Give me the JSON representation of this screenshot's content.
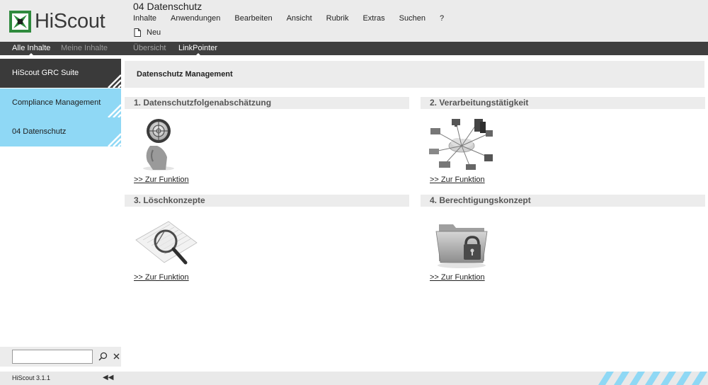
{
  "app": {
    "logo_text": "HiScout",
    "brand_color": "#2f8a3d"
  },
  "header": {
    "doc_title": "04 Datenschutz",
    "menu": [
      "Inhalte",
      "Anwendungen",
      "Bearbeiten",
      "Ansicht",
      "Rubrik",
      "Extras",
      "Suchen",
      "?"
    ],
    "new_label": "Neu"
  },
  "tabs": {
    "left": [
      "Alle Inhalte",
      "Meine Inhalte"
    ],
    "right": [
      "Übersicht",
      "LinkPointer"
    ],
    "active_left": "Alle Inhalte",
    "active_right": "LinkPointer"
  },
  "sidebar": {
    "items": [
      {
        "label": "HiScout GRC Suite",
        "style": "dark"
      },
      {
        "label": "Compliance Management",
        "style": "blue"
      },
      {
        "label": "04 Datenschutz",
        "style": "blue"
      }
    ],
    "search": {
      "value": "",
      "placeholder": ""
    }
  },
  "main": {
    "title": "Datenschutz Management",
    "sections": [
      {
        "title": "1. Datenschutzfolgenabschätzung",
        "link": ">> Zur Funktion",
        "icon": "target-icon"
      },
      {
        "title": "2. Verarbeitungstätigkeit",
        "link": ">> Zur Funktion",
        "icon": "network-icon"
      },
      {
        "title": "3. Löschkonzepte",
        "link": ">> Zur Funktion",
        "icon": "magnifier-document-icon"
      },
      {
        "title": "4. Berechtigungskonzept",
        "link": ">> Zur Funktion",
        "icon": "locked-folder-icon"
      }
    ]
  },
  "footer": {
    "version": "HiScout 3.1.1",
    "accent": "#8fd8f5"
  }
}
